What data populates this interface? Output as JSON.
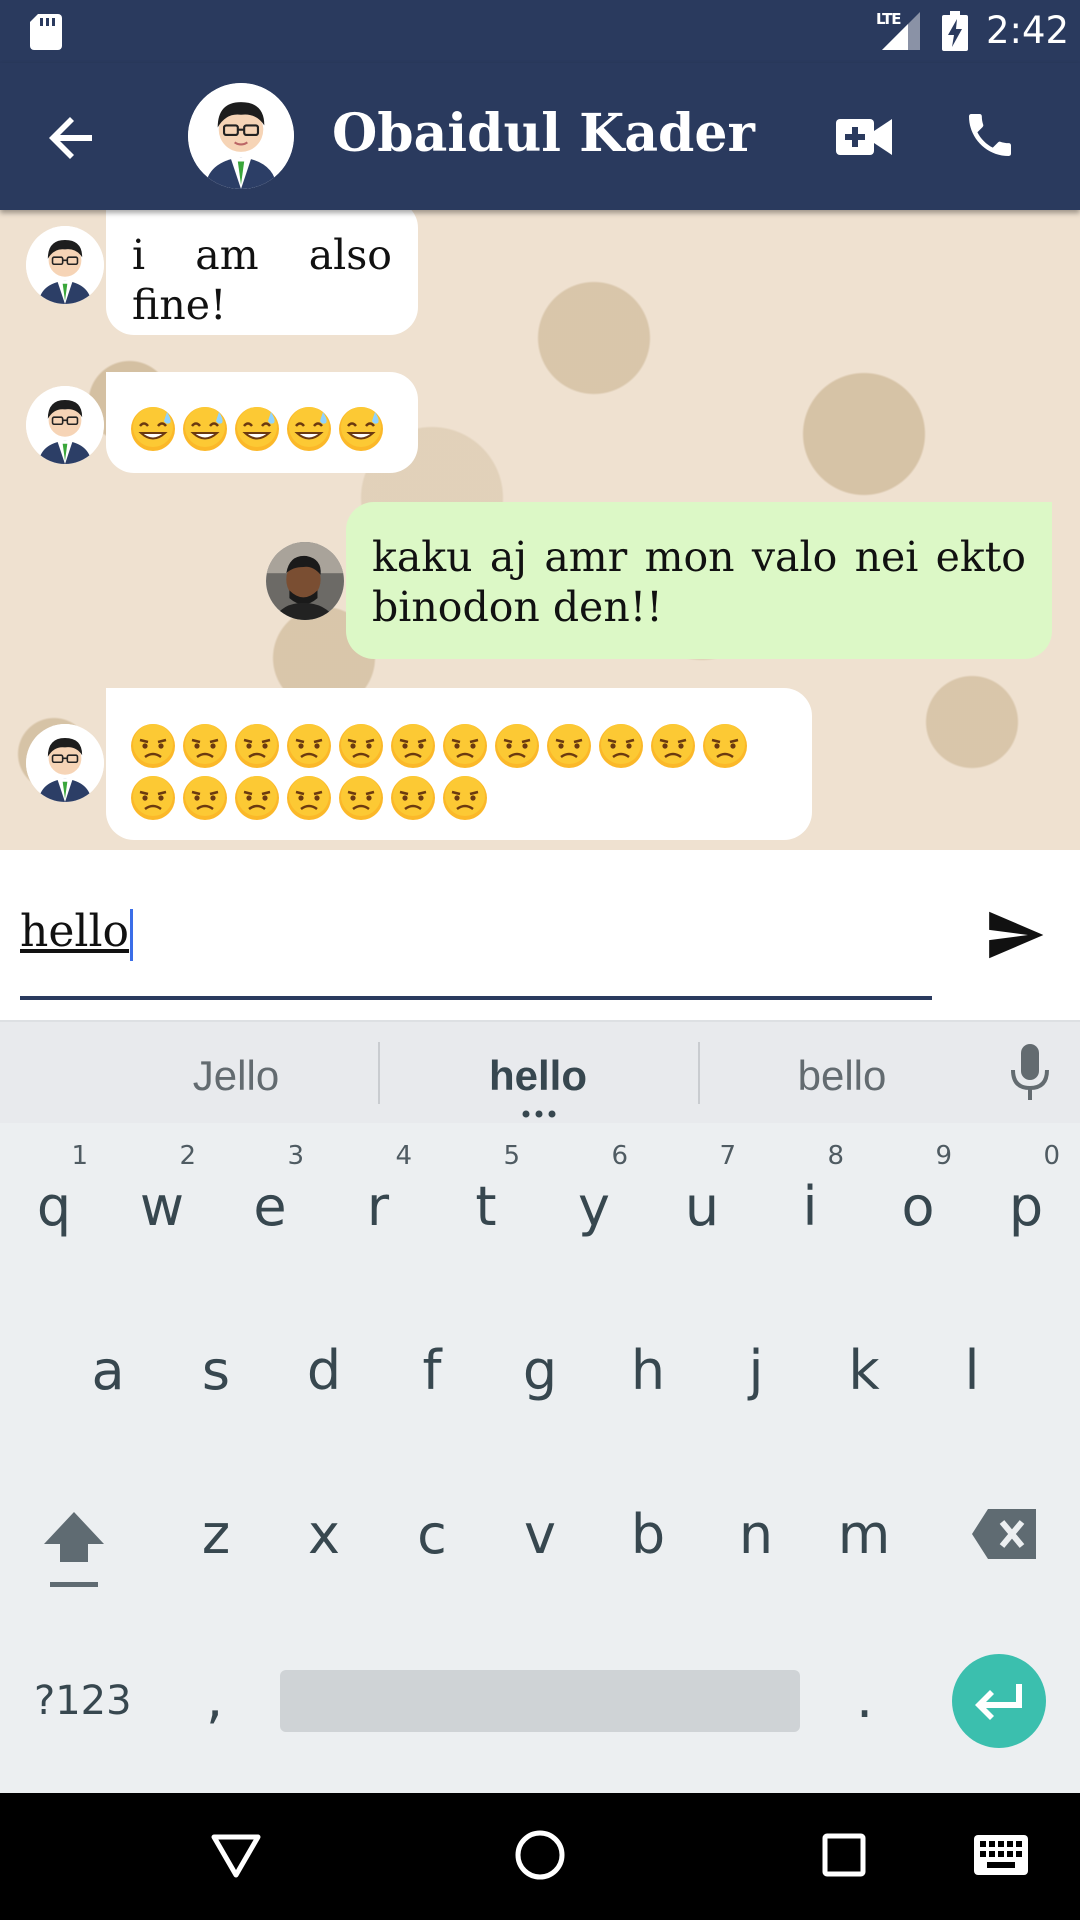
{
  "status_bar": {
    "network": "LTE",
    "time": "2:42"
  },
  "toolbar": {
    "contact_name": "Obaidul Kader",
    "icons": [
      "back-arrow-icon",
      "video-call-icon",
      "phone-icon"
    ]
  },
  "messages": [
    {
      "direction": "incoming",
      "text": "i am also fine!",
      "line1": "i am also",
      "line2": "fine!"
    },
    {
      "direction": "incoming",
      "emoji": "smiling-face-with-sweat",
      "emoji_count": 5
    },
    {
      "direction": "outgoing",
      "text": "kaku aj amr mon valo nei ekto binodon den!!",
      "line1": "kaku aj amr mon valo nei ekto",
      "line2": "binodon den!!"
    },
    {
      "direction": "incoming",
      "emoji": "frowning-face",
      "emoji_count": 19
    }
  ],
  "composer": {
    "value": "hello",
    "send_icon": "send-icon"
  },
  "keyboard": {
    "suggestions": [
      "Jello",
      "hello",
      "bello"
    ],
    "row1": [
      {
        "k": "q",
        "n": "1"
      },
      {
        "k": "w",
        "n": "2"
      },
      {
        "k": "e",
        "n": "3"
      },
      {
        "k": "r",
        "n": "4"
      },
      {
        "k": "t",
        "n": "5"
      },
      {
        "k": "y",
        "n": "6"
      },
      {
        "k": "u",
        "n": "7"
      },
      {
        "k": "i",
        "n": "8"
      },
      {
        "k": "o",
        "n": "9"
      },
      {
        "k": "p",
        "n": "0"
      }
    ],
    "row2": [
      "a",
      "s",
      "d",
      "f",
      "g",
      "h",
      "j",
      "k",
      "l"
    ],
    "row3": [
      "z",
      "x",
      "c",
      "v",
      "b",
      "n",
      "m"
    ],
    "symbols_label": "?123",
    "comma": ",",
    "period": "."
  },
  "colors": {
    "primary": "#2a3a5e",
    "outgoing_bubble": "#dcf8c6",
    "accent_enter": "#3bbfae"
  }
}
